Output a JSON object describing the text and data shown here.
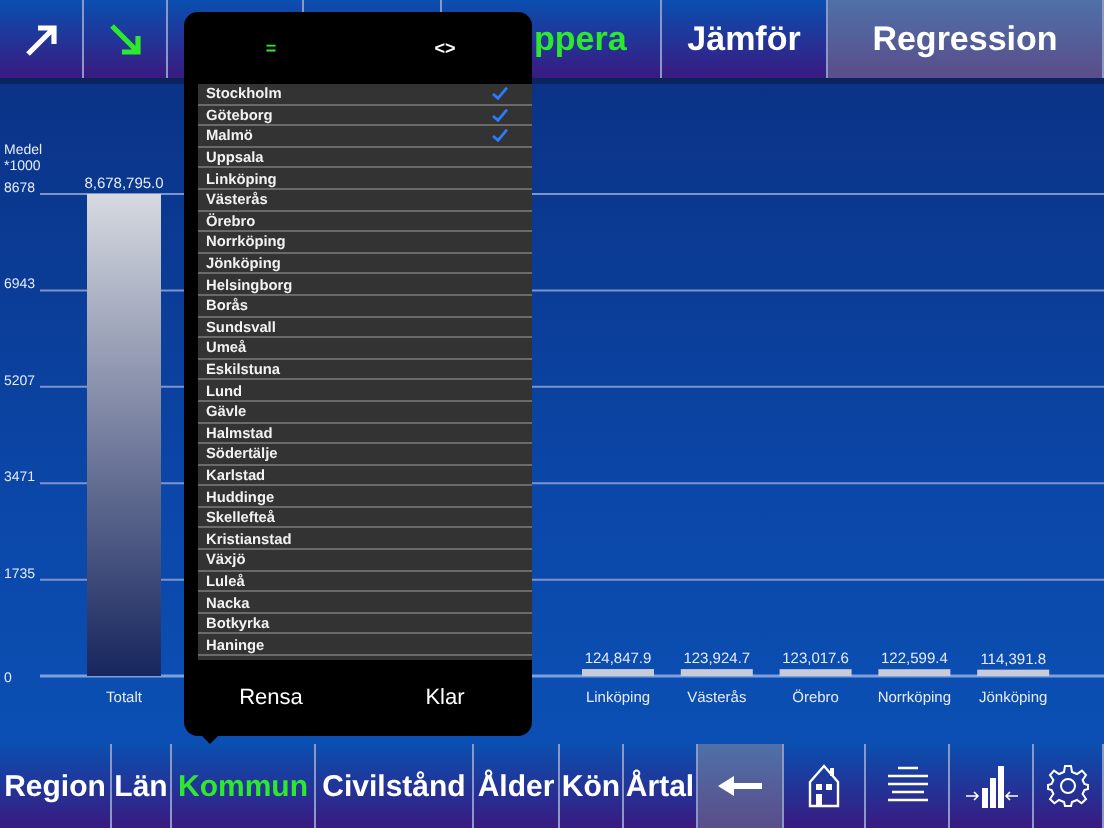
{
  "top_bar": [
    {
      "kind": "icon",
      "selected": false,
      "highlighted": false
    },
    {
      "kind": "icon",
      "selected": true,
      "highlighted": false
    },
    {
      "kind": "empty",
      "highlighted": false
    },
    {
      "kind": "empty",
      "highlighted": false
    },
    {
      "kind": "text",
      "label": "ppera",
      "selected": true,
      "highlighted": false
    },
    {
      "kind": "text",
      "label": "Jämför",
      "selected": false,
      "highlighted": false
    },
    {
      "kind": "text",
      "label": "Regression",
      "selected": false,
      "highlighted": true
    }
  ],
  "chart": {
    "chart_data": {
      "type": "bar",
      "ylabel": "Medel *1000",
      "categories": [
        "Totalt",
        null,
        null,
        null,
        null,
        "Linköping",
        "Västerås",
        "Örebro",
        "Norrköping",
        "Jönköping"
      ],
      "values": [
        8678.795,
        null,
        null,
        null,
        null,
        124.848,
        123.925,
        123.018,
        122.599,
        114.392
      ],
      "ylim": [
        0,
        8678.795
      ],
      "yticks": [
        0,
        1735,
        3471,
        5207,
        6943,
        8678
      ],
      "grid": true
    },
    "bar_value_texts": [
      "8,678,795.0",
      "124,847.9",
      "123,924.7",
      "123,017.6",
      "122,599.4",
      "114,391.8"
    ]
  },
  "popover": {
    "segments": [
      {
        "label": "=",
        "selected": true
      },
      {
        "label": "<>",
        "selected": false
      }
    ],
    "items": [
      {
        "label": "Stockholm",
        "checked": true
      },
      {
        "label": "Göteborg",
        "checked": true
      },
      {
        "label": "Malmö",
        "checked": true
      },
      {
        "label": "Uppsala",
        "checked": false
      },
      {
        "label": "Linköping",
        "checked": false
      },
      {
        "label": "Västerås",
        "checked": false
      },
      {
        "label": "Örebro",
        "checked": false
      },
      {
        "label": "Norrköping",
        "checked": false
      },
      {
        "label": "Jönköping",
        "checked": false
      },
      {
        "label": "Helsingborg",
        "checked": false
      },
      {
        "label": "Borås",
        "checked": false
      },
      {
        "label": "Sundsvall",
        "checked": false
      },
      {
        "label": "Umeå",
        "checked": false
      },
      {
        "label": "Eskilstuna",
        "checked": false
      },
      {
        "label": "Lund",
        "checked": false
      },
      {
        "label": "Gävle",
        "checked": false
      },
      {
        "label": "Halmstad",
        "checked": false
      },
      {
        "label": "Södertälje",
        "checked": false
      },
      {
        "label": "Karlstad",
        "checked": false
      },
      {
        "label": "Huddinge",
        "checked": false
      },
      {
        "label": "Skellefteå",
        "checked": false
      },
      {
        "label": "Kristianstad",
        "checked": false
      },
      {
        "label": "Växjö",
        "checked": false
      },
      {
        "label": "Luleå",
        "checked": false
      },
      {
        "label": "Nacka",
        "checked": false
      },
      {
        "label": "Botkyrka",
        "checked": false
      },
      {
        "label": "Haninge",
        "checked": false
      }
    ],
    "buttons": [
      "Rensa",
      "Klar"
    ]
  },
  "bottom_bar": [
    {
      "kind": "text",
      "label": "Region",
      "selected": false,
      "highlighted": false
    },
    {
      "kind": "text",
      "label": "Län",
      "selected": false,
      "highlighted": false
    },
    {
      "kind": "text",
      "label": "Kommun",
      "selected": true,
      "highlighted": false
    },
    {
      "kind": "text",
      "label": "Civilstånd",
      "selected": false,
      "highlighted": false
    },
    {
      "kind": "text",
      "label": "Ålder",
      "selected": false,
      "highlighted": false
    },
    {
      "kind": "text",
      "label": "Kön",
      "selected": false,
      "highlighted": false
    },
    {
      "kind": "text",
      "label": "Årtal",
      "selected": false,
      "highlighted": false
    },
    {
      "kind": "icon",
      "selected": false,
      "highlighted": true
    },
    {
      "kind": "icon",
      "selected": false,
      "highlighted": false
    },
    {
      "kind": "icon",
      "selected": false,
      "highlighted": false
    },
    {
      "kind": "icon",
      "selected": false,
      "highlighted": false
    },
    {
      "kind": "icon",
      "selected": false,
      "highlighted": false
    }
  ]
}
